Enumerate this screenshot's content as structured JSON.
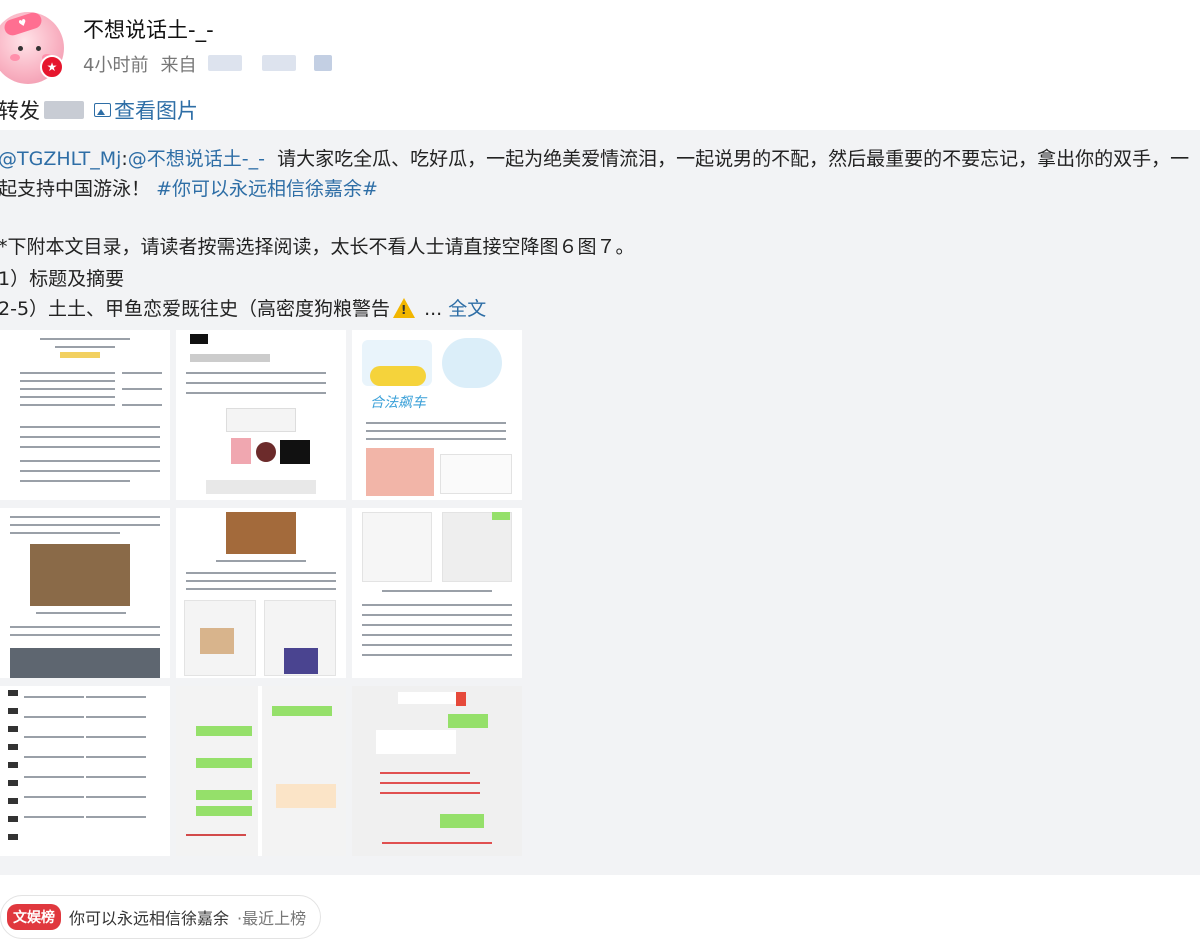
{
  "post": {
    "username": "不想说话土-_-",
    "time": "4小时前",
    "source_prefix": "来自",
    "repost_prefix": "转发",
    "view_images": "查看图片"
  },
  "retweet": {
    "mention": "@TGZHLT_Mj",
    "mention2": "@不想说话土-_-",
    "text_main": "请大家吃全瓜、吃好瓜，一起为绝美爱情流泪，一起说男的不配，然后最重要的不要忘记，拿出你的双手，一起支持中国游泳！",
    "hashtag": "#你可以永远相信徐嘉余#",
    "line_toc": "*下附本文目录，请读者按需选择阅读，太长不看人士请直接空降图６图７。",
    "line_1": "1）标题及摘要",
    "line_2": "2-5）土土、甲鱼恋爱既往史（高密度狗粮警告",
    "ellipsis": "...",
    "full_text": "全文",
    "caption_img3": "合法飙车"
  },
  "footer": {
    "tag": "文娱榜",
    "topic": "你可以永远相信徐嘉余",
    "status": "·最近上榜"
  },
  "colors": {
    "link": "#2e6ea6",
    "tag_red": "#e0383e",
    "warning": "#f2b600"
  },
  "icons": {
    "image": "image-icon",
    "warning": "warning-icon",
    "badge": "v-badge-icon"
  }
}
